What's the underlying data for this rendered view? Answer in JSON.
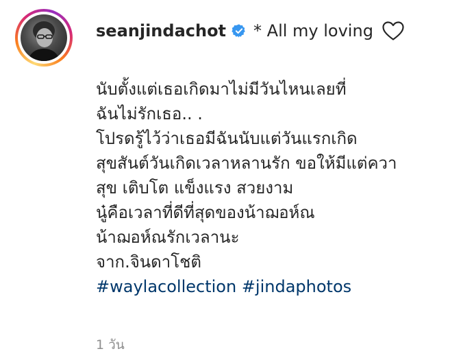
{
  "comment": {
    "username": "seanjindachot",
    "verified": true,
    "headline": "* All my loving",
    "caption_lines": [
      "นับตั้งแต่เธอเกิดมาไม่มีวันไหนเลยที่",
      "ฉันไม่รักเธอ.. .",
      "โปรดรู้ไว้ว่าเธอมีฉันนับแต่วันแรกเกิด",
      "สุขสันต์วันเกิดเวลาหลานรัก ขอให้มีแต่ควา",
      "สุข เติบโต แข็งแรง สวยงาม",
      "นู๋คือเวลาที่ดีที่สุดของน้าฌอห์ณ",
      "น้าฌอห์ณรักเวลานะ",
      "จาก.จินดาโชติ"
    ],
    "hashtags": [
      "#waylacollection",
      "#jindaphotos"
    ],
    "timestamp": "1 วัน"
  },
  "colors": {
    "text": "#262626",
    "hashtag": "#00376b",
    "verified_badge": "#3897f0",
    "muted": "#8e8e8e"
  },
  "icons": {
    "verified": "verified-badge-icon",
    "like": "heart-outline-icon"
  }
}
